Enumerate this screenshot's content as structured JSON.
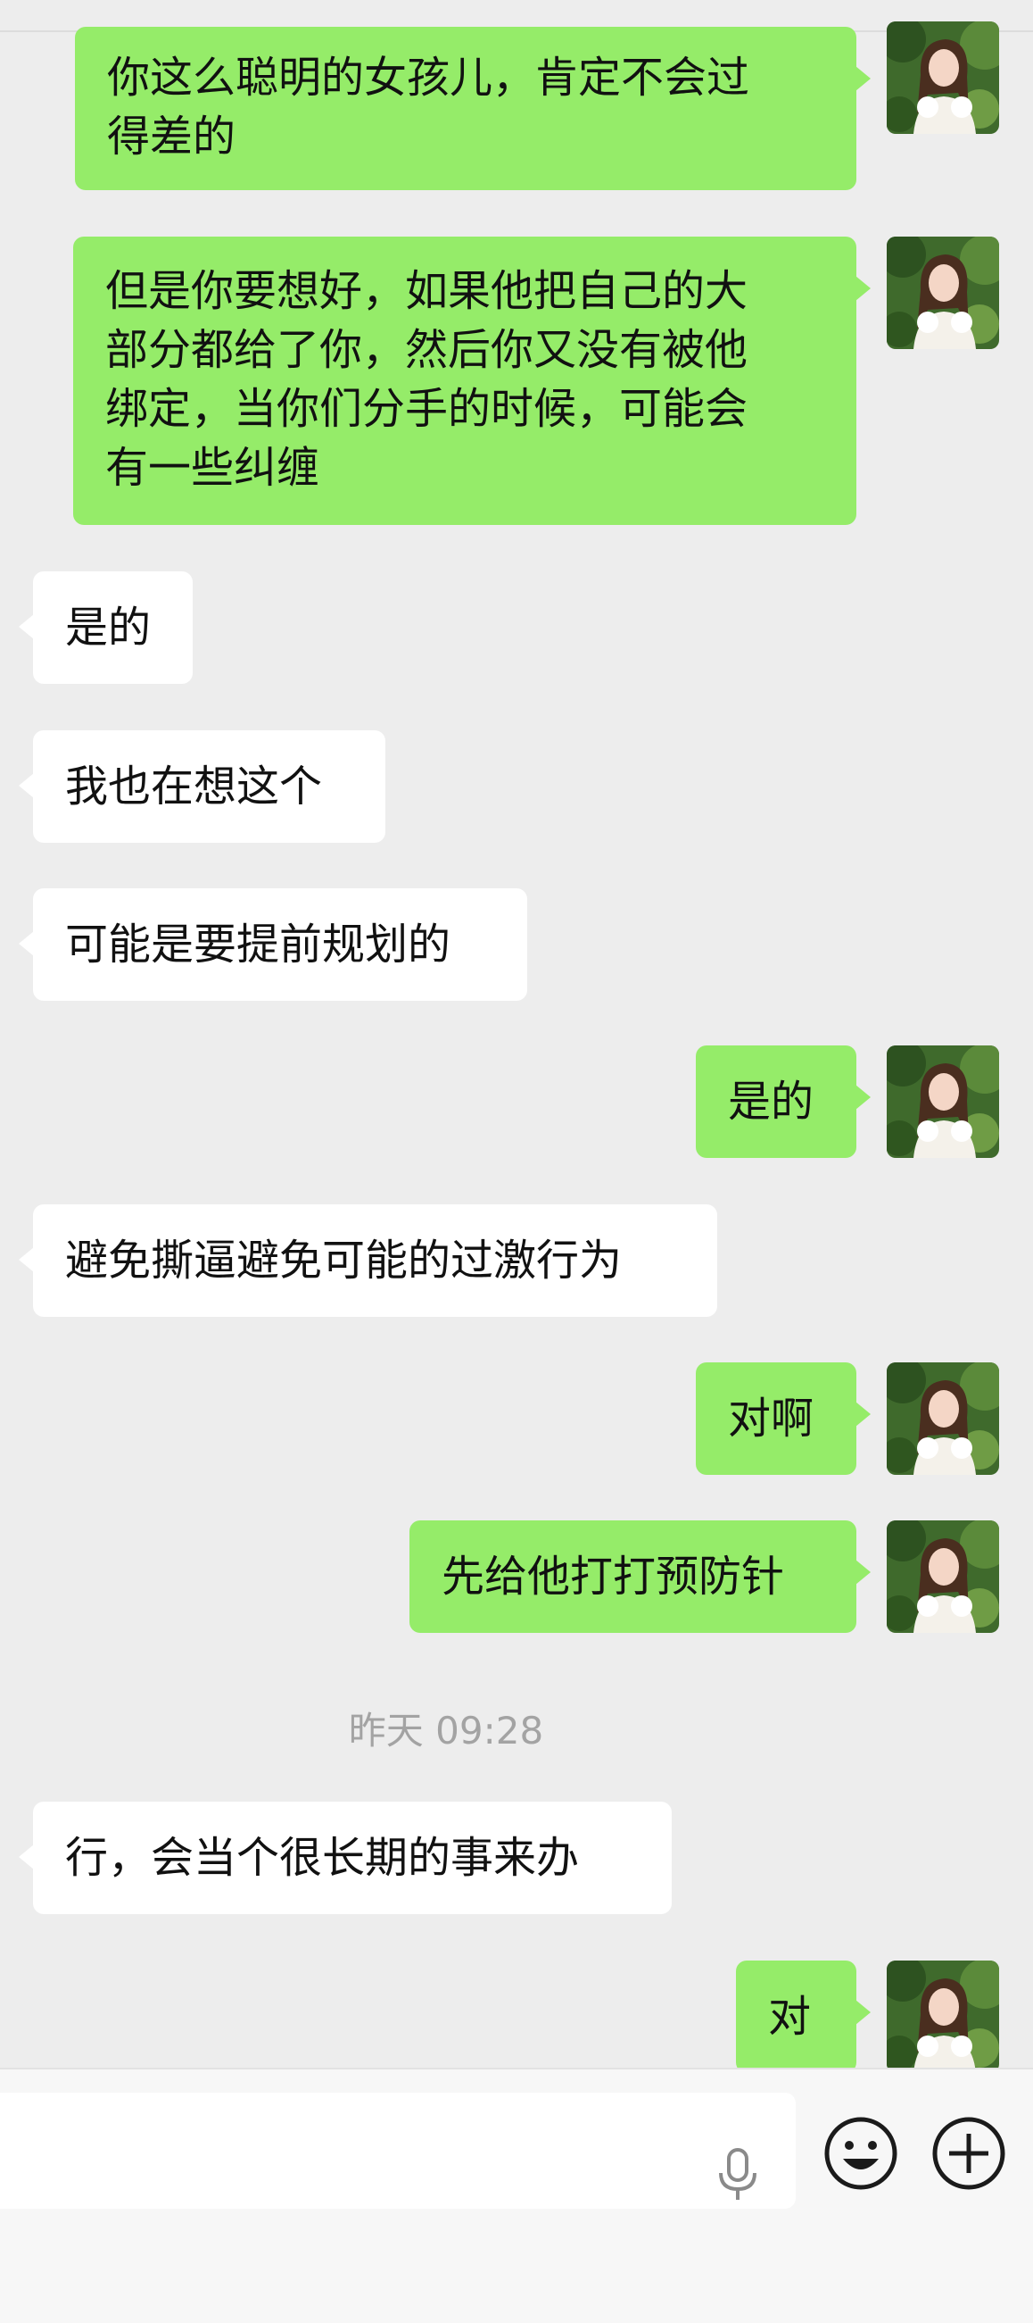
{
  "messages": [
    {
      "side": "me",
      "text": "你这么聪明的女孩儿，肯定不会过\n得差的"
    },
    {
      "side": "me",
      "text": "但是你要想好，如果他把自己的大\n部分都给了你，然后你又没有被他\n绑定，当你们分手的时候，可能会\n有一些纠缠"
    },
    {
      "side": "them",
      "text": "是的"
    },
    {
      "side": "them",
      "text": "我也在想这个"
    },
    {
      "side": "them",
      "text": "可能是要提前规划的"
    },
    {
      "side": "me",
      "text": "是的"
    },
    {
      "side": "them",
      "text": "避免撕逼避免可能的过激行为"
    },
    {
      "side": "me",
      "text": "对啊"
    },
    {
      "side": "me",
      "text": "先给他打打预防针"
    },
    {
      "side": "them",
      "text": "行，会当个很长期的事来办"
    },
    {
      "side": "me",
      "text": "对"
    }
  ],
  "timestamp": "昨天 09:28",
  "icons": {
    "avatar": "user-avatar",
    "voice": "microphone-icon",
    "emoji": "emoji-icon",
    "more": "plus-circle-icon"
  },
  "colors": {
    "sent_bubble": "#95ec69",
    "received_bubble": "#ffffff",
    "background": "#ededed"
  }
}
